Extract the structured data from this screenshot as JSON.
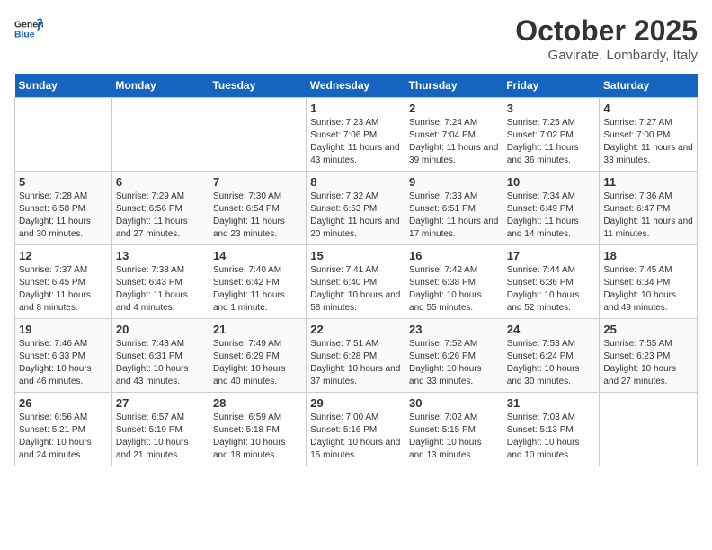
{
  "header": {
    "logo_general": "General",
    "logo_blue": "Blue",
    "month": "October 2025",
    "location": "Gavirate, Lombardy, Italy"
  },
  "days_of_week": [
    "Sunday",
    "Monday",
    "Tuesday",
    "Wednesday",
    "Thursday",
    "Friday",
    "Saturday"
  ],
  "weeks": [
    [
      {
        "day": "",
        "info": ""
      },
      {
        "day": "",
        "info": ""
      },
      {
        "day": "",
        "info": ""
      },
      {
        "day": "1",
        "info": "Sunrise: 7:23 AM\nSunset: 7:06 PM\nDaylight: 11 hours and 43 minutes."
      },
      {
        "day": "2",
        "info": "Sunrise: 7:24 AM\nSunset: 7:04 PM\nDaylight: 11 hours and 39 minutes."
      },
      {
        "day": "3",
        "info": "Sunrise: 7:25 AM\nSunset: 7:02 PM\nDaylight: 11 hours and 36 minutes."
      },
      {
        "day": "4",
        "info": "Sunrise: 7:27 AM\nSunset: 7:00 PM\nDaylight: 11 hours and 33 minutes."
      }
    ],
    [
      {
        "day": "5",
        "info": "Sunrise: 7:28 AM\nSunset: 6:58 PM\nDaylight: 11 hours and 30 minutes."
      },
      {
        "day": "6",
        "info": "Sunrise: 7:29 AM\nSunset: 6:56 PM\nDaylight: 11 hours and 27 minutes."
      },
      {
        "day": "7",
        "info": "Sunrise: 7:30 AM\nSunset: 6:54 PM\nDaylight: 11 hours and 23 minutes."
      },
      {
        "day": "8",
        "info": "Sunrise: 7:32 AM\nSunset: 6:53 PM\nDaylight: 11 hours and 20 minutes."
      },
      {
        "day": "9",
        "info": "Sunrise: 7:33 AM\nSunset: 6:51 PM\nDaylight: 11 hours and 17 minutes."
      },
      {
        "day": "10",
        "info": "Sunrise: 7:34 AM\nSunset: 6:49 PM\nDaylight: 11 hours and 14 minutes."
      },
      {
        "day": "11",
        "info": "Sunrise: 7:36 AM\nSunset: 6:47 PM\nDaylight: 11 hours and 11 minutes."
      }
    ],
    [
      {
        "day": "12",
        "info": "Sunrise: 7:37 AM\nSunset: 6:45 PM\nDaylight: 11 hours and 8 minutes."
      },
      {
        "day": "13",
        "info": "Sunrise: 7:38 AM\nSunset: 6:43 PM\nDaylight: 11 hours and 4 minutes."
      },
      {
        "day": "14",
        "info": "Sunrise: 7:40 AM\nSunset: 6:42 PM\nDaylight: 11 hours and 1 minute."
      },
      {
        "day": "15",
        "info": "Sunrise: 7:41 AM\nSunset: 6:40 PM\nDaylight: 10 hours and 58 minutes."
      },
      {
        "day": "16",
        "info": "Sunrise: 7:42 AM\nSunset: 6:38 PM\nDaylight: 10 hours and 55 minutes."
      },
      {
        "day": "17",
        "info": "Sunrise: 7:44 AM\nSunset: 6:36 PM\nDaylight: 10 hours and 52 minutes."
      },
      {
        "day": "18",
        "info": "Sunrise: 7:45 AM\nSunset: 6:34 PM\nDaylight: 10 hours and 49 minutes."
      }
    ],
    [
      {
        "day": "19",
        "info": "Sunrise: 7:46 AM\nSunset: 6:33 PM\nDaylight: 10 hours and 46 minutes."
      },
      {
        "day": "20",
        "info": "Sunrise: 7:48 AM\nSunset: 6:31 PM\nDaylight: 10 hours and 43 minutes."
      },
      {
        "day": "21",
        "info": "Sunrise: 7:49 AM\nSunset: 6:29 PM\nDaylight: 10 hours and 40 minutes."
      },
      {
        "day": "22",
        "info": "Sunrise: 7:51 AM\nSunset: 6:28 PM\nDaylight: 10 hours and 37 minutes."
      },
      {
        "day": "23",
        "info": "Sunrise: 7:52 AM\nSunset: 6:26 PM\nDaylight: 10 hours and 33 minutes."
      },
      {
        "day": "24",
        "info": "Sunrise: 7:53 AM\nSunset: 6:24 PM\nDaylight: 10 hours and 30 minutes."
      },
      {
        "day": "25",
        "info": "Sunrise: 7:55 AM\nSunset: 6:23 PM\nDaylight: 10 hours and 27 minutes."
      }
    ],
    [
      {
        "day": "26",
        "info": "Sunrise: 6:56 AM\nSunset: 5:21 PM\nDaylight: 10 hours and 24 minutes."
      },
      {
        "day": "27",
        "info": "Sunrise: 6:57 AM\nSunset: 5:19 PM\nDaylight: 10 hours and 21 minutes."
      },
      {
        "day": "28",
        "info": "Sunrise: 6:59 AM\nSunset: 5:18 PM\nDaylight: 10 hours and 18 minutes."
      },
      {
        "day": "29",
        "info": "Sunrise: 7:00 AM\nSunset: 5:16 PM\nDaylight: 10 hours and 15 minutes."
      },
      {
        "day": "30",
        "info": "Sunrise: 7:02 AM\nSunset: 5:15 PM\nDaylight: 10 hours and 13 minutes."
      },
      {
        "day": "31",
        "info": "Sunrise: 7:03 AM\nSunset: 5:13 PM\nDaylight: 10 hours and 10 minutes."
      },
      {
        "day": "",
        "info": ""
      }
    ]
  ]
}
